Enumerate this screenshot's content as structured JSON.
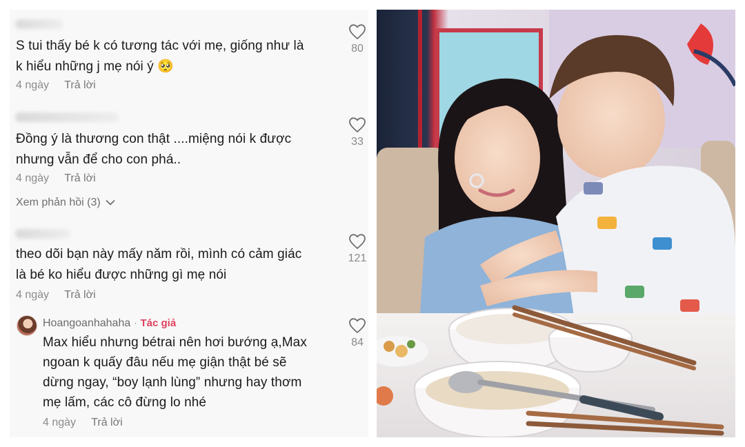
{
  "comments": [
    {
      "text": "S tui thấy bé k có tương tác với mẹ, giống như là\nk hiểu những j mẹ nói ý 🥺",
      "date": "4 ngày",
      "reply_label": "Trả lời",
      "likes": "80"
    },
    {
      "text": "Đồng ý là thương con thật ....miệng nói k được\nnhưng vẫn để cho con phá..",
      "date": "4 ngày",
      "reply_label": "Trả lời",
      "likes": "33",
      "view_replies": "Xem phản hồi (3)"
    },
    {
      "text": "theo dõi bạn này mấy năm rồi, mình có cảm giác\nlà bé ko hiểu được những gì mẹ nói",
      "date": "4 ngày",
      "reply_label": "Trả lời",
      "likes": "121"
    }
  ],
  "reply": {
    "username": "Hoangoanhahaha",
    "separator": "·",
    "author_tag": "Tác giả",
    "text": "Max hiểu nhưng bétrai nên hơi bướng ạ,Max\nngoan k quấy đâu nếu mẹ giận thật bé sẽ\ndừng ngay, “boy lạnh lùng” nhưng hay thơm\nmẹ lấm, các cô đừng lo nhé",
    "date": "4 ngày",
    "reply_label": "Trả lời",
    "likes": "84"
  },
  "icons": {
    "like": "heart-outline-icon",
    "expand": "chevron-down-icon"
  },
  "colors": {
    "author_tag": "#e0405f",
    "meta": "#8a8a8a",
    "text": "#1a1a1a"
  }
}
